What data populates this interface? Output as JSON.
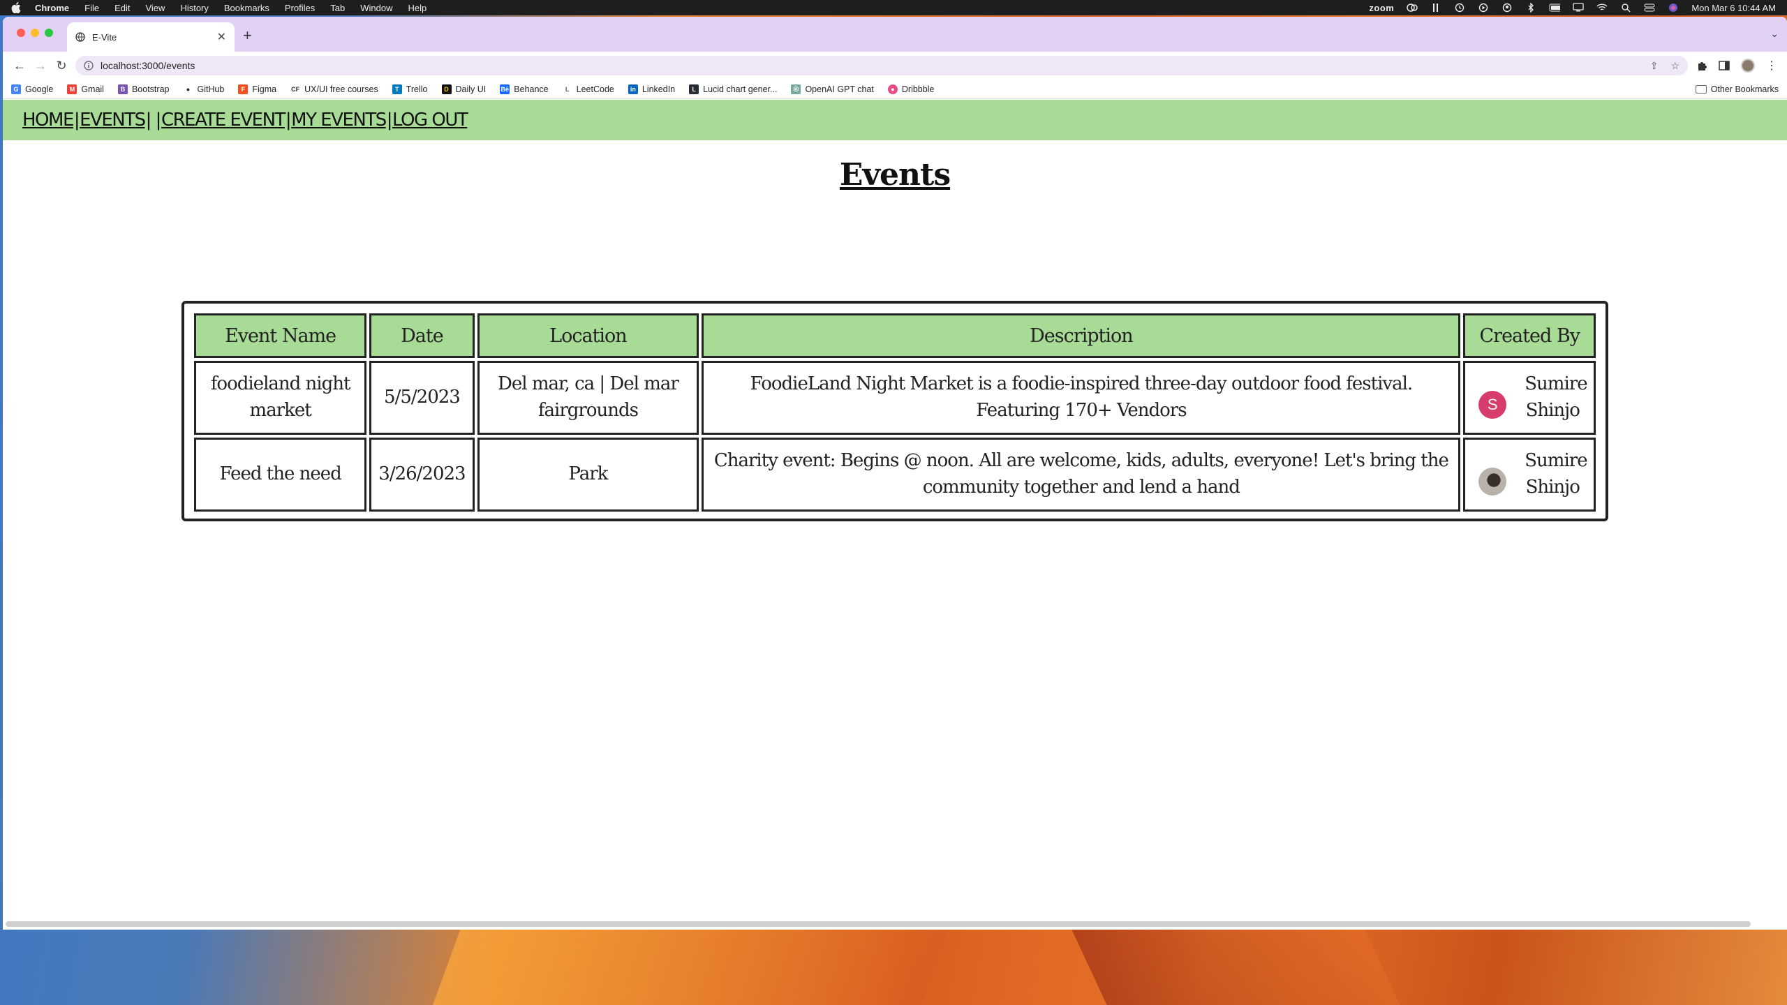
{
  "menubar": {
    "app_name": "Chrome",
    "items": [
      "File",
      "Edit",
      "View",
      "History",
      "Bookmarks",
      "Profiles",
      "Tab",
      "Window",
      "Help"
    ],
    "zoom_label": "zoom",
    "datetime": "Mon Mar 6  10:44 AM"
  },
  "browser": {
    "tab_title": "E-Vite",
    "url": "localhost:3000/events",
    "bookmarks": [
      {
        "label": "Google",
        "icon": "google-icon",
        "color": "#4285f4"
      },
      {
        "label": "Gmail",
        "icon": "gmail-icon",
        "color": "#ea4335"
      },
      {
        "label": "Bootstrap",
        "icon": "bootstrap-icon",
        "color": "#7952b3"
      },
      {
        "label": "GitHub",
        "icon": "github-icon",
        "color": "#222222"
      },
      {
        "label": "Figma",
        "icon": "figma-icon",
        "color": "#f24e1e"
      },
      {
        "label": "UX/UI free courses",
        "icon": "cf-icon",
        "color": "#333333"
      },
      {
        "label": "Trello",
        "icon": "trello-icon",
        "color": "#0079bf"
      },
      {
        "label": "Daily UI",
        "icon": "dailyui-icon",
        "color": "#111111"
      },
      {
        "label": "Behance",
        "icon": "behance-icon",
        "color": "#1769ff"
      },
      {
        "label": "LeetCode",
        "icon": "leetcode-icon",
        "color": "#555555"
      },
      {
        "label": "LinkedIn",
        "icon": "linkedin-icon",
        "color": "#0a66c2"
      },
      {
        "label": "Lucid chart gener...",
        "icon": "lucid-icon",
        "color": "#282c33"
      },
      {
        "label": "OpenAI GPT chat",
        "icon": "openai-icon",
        "color": "#74aa9c"
      },
      {
        "label": "Dribbble",
        "icon": "dribbble-icon",
        "color": "#ea4c89"
      }
    ],
    "other_bookmarks": "Other Bookmarks"
  },
  "nav": {
    "home": "Home",
    "events": "Events",
    "create_event": "Create Event",
    "my_events": "My Events",
    "log_out": "Log Out"
  },
  "page": {
    "title": "Events"
  },
  "table": {
    "headers": [
      "Event Name",
      "Date",
      "Location",
      "Description",
      "Created By"
    ],
    "rows": [
      {
        "name": "foodieland night market",
        "date": "5/5/2023",
        "location": "Del mar, ca | Del mar fairgrounds",
        "description": "FoodieLand Night Market is a foodie-inspired three-day outdoor food festival. Featuring 170+ Vendors",
        "created_by": "Sumire Shinjo",
        "avatar_letter": "S",
        "avatar_type": "letter"
      },
      {
        "name": "Feed the need",
        "date": "3/26/2023",
        "location": "Park",
        "description": "Charity event: Begins @ noon. All are welcome, kids, adults, everyone! Let's bring the community together and lend a hand",
        "created_by": "Sumire Shinjo",
        "avatar_letter": "",
        "avatar_type": "photo"
      }
    ]
  },
  "colors": {
    "nav_green": "#a8dc96",
    "header_green": "#a8dc96",
    "avatar_pink": "#d63d6c",
    "tabstrip_lavender": "#e2d1f5"
  }
}
